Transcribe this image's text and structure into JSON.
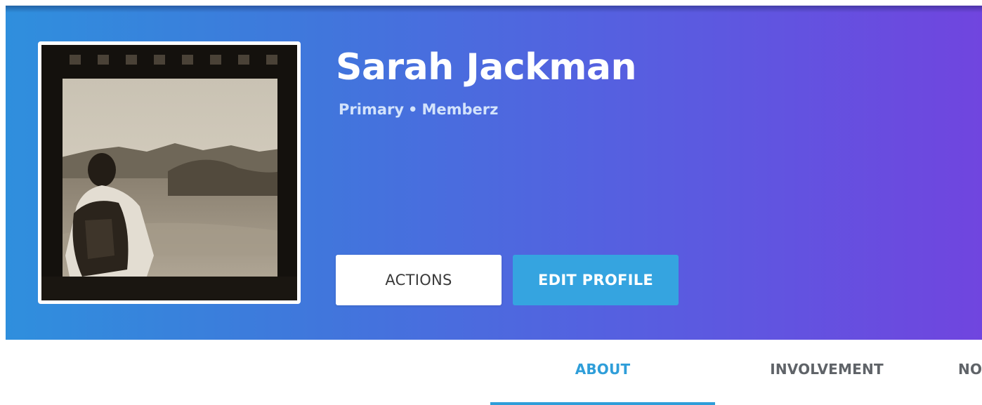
{
  "profile": {
    "name": "Sarah Jackman",
    "role": "Primary",
    "separator": "•",
    "group": "Memberz",
    "photo_icon": "profile-photo"
  },
  "actions": {
    "actions_label": "ACTIONS",
    "edit_label": "EDIT PROFILE"
  },
  "tabs": {
    "items": [
      {
        "label": "ABOUT",
        "active": true
      },
      {
        "label": "INVOLVEMENT",
        "active": false
      },
      {
        "label": "NO",
        "active": false
      }
    ]
  },
  "colors": {
    "accent": "#35a4e0",
    "gradient_start": "#2f8fdd",
    "gradient_end": "#7045df",
    "tab_active": "#2f9ed9",
    "tab_inactive": "#5f6368"
  }
}
